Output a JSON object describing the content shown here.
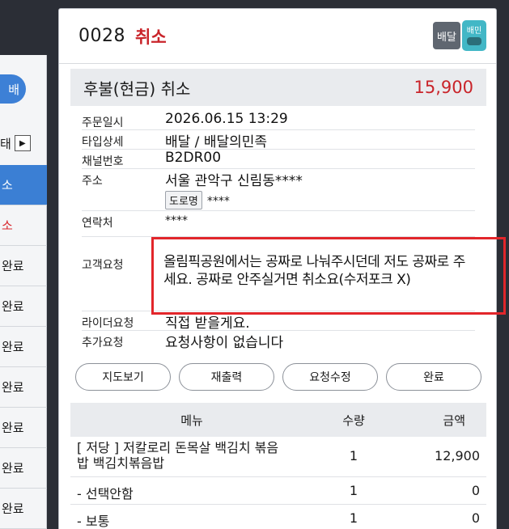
{
  "left_list": {
    "pill_label": "배",
    "state_label": "태",
    "items": [
      "소",
      "소",
      "완료",
      "완료",
      "완료",
      "완료",
      "완료",
      "완료",
      "완료"
    ]
  },
  "order": {
    "number": "0028",
    "status": "취소",
    "delivery_badge": "배달",
    "app_logo_text": "배민"
  },
  "summary": {
    "label": "후불(현금) 취소",
    "amount": "15,900"
  },
  "info": {
    "order_time_label": "주문일시",
    "order_time": "2026.06.15 13:29",
    "type_label": "타입상세",
    "type": "배달 / 배달의민족",
    "channel_label": "채널번호",
    "channel": "B2DR00",
    "address_label": "주소",
    "address": "서울 관악구 신림동****",
    "road_label": "도로명",
    "road_value": "****",
    "contact_label": "연락처",
    "contact": "****",
    "customer_req_label": "고객요청",
    "customer_req": "올림픽공원에서는 공짜로 나눠주시던데 저도 공짜로 주세요. 공짜로 안주실거면 취소요(수저포크 X)",
    "rider_req_label": "라이더요청",
    "rider_req": "직접 받을게요.",
    "extra_req_label": "추가요청",
    "extra_req": "요청사항이 없습니다"
  },
  "buttons": {
    "map": "지도보기",
    "reprint": "재출력",
    "edit_request": "요청수정",
    "complete": "완료"
  },
  "menu": {
    "headers": {
      "name": "메뉴",
      "qty": "수량",
      "amount": "금액"
    },
    "rows": [
      {
        "name": "[ 저당 ] 저칼로리 돈목살 백김치 볶음밥 백김치볶음밥",
        "qty": "1",
        "amount": "12,900"
      },
      {
        "name": "- 선택안함",
        "qty": "1",
        "amount": "0"
      },
      {
        "name": "- 보통",
        "qty": "1",
        "amount": "0"
      }
    ]
  },
  "colors": {
    "accent_red": "#c9242a",
    "highlight_red": "#e2262b",
    "left_active": "#3b7fd4"
  }
}
